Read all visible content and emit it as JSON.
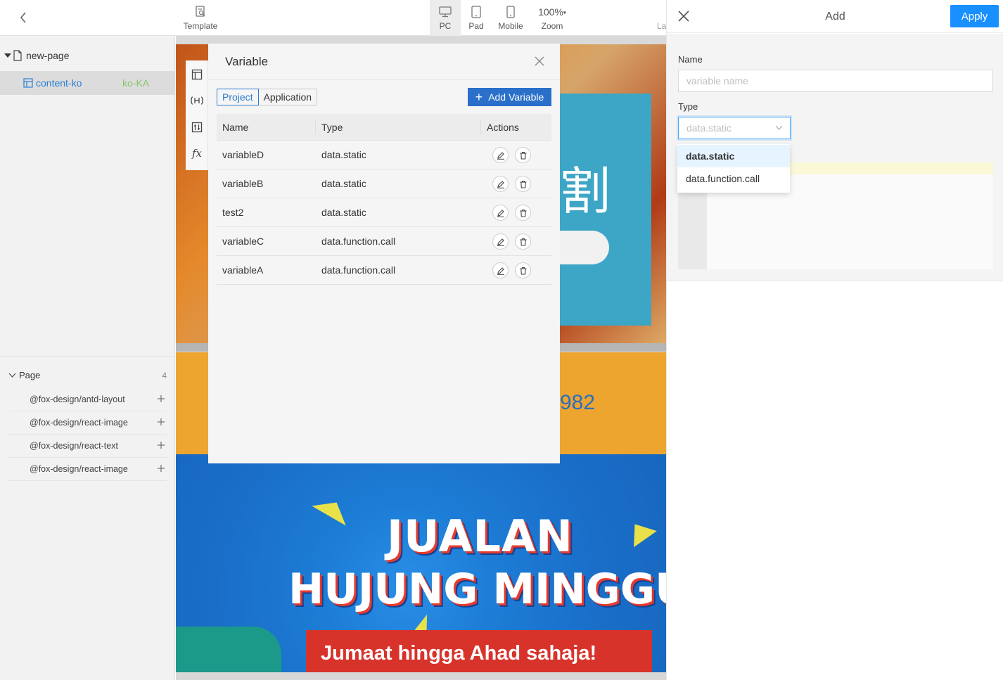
{
  "toolbar": {
    "template_label": "Template",
    "pc_label": "PC",
    "pad_label": "Pad",
    "mobile_label": "Mobile",
    "zoom_value": "100%",
    "zoom_label": "Zoom",
    "cut_label": "La"
  },
  "tree": {
    "root_label": "new-page",
    "child_label": "content-ko",
    "child_lang": "ko-KA"
  },
  "library": {
    "section_label": "Page",
    "count": "4",
    "items": [
      {
        "label": "@fox-design/antd-layout"
      },
      {
        "label": "@fox-design/react-image"
      },
      {
        "label": "@fox-design/react-text"
      },
      {
        "label": "@fox-design/react-image"
      }
    ]
  },
  "canvas": {
    "hero_char": "割",
    "orange_number": "982",
    "promo_title": "JUALAN",
    "promo_subtitle": "HUJUNG MINGGU",
    "promo_tagline": "Jumaat hingga Ahad sahaja!"
  },
  "tools": {
    "fx_label": "fx"
  },
  "variable_modal": {
    "title": "Variable",
    "tabs": [
      {
        "label": "Project",
        "active": true
      },
      {
        "label": "Application",
        "active": false
      }
    ],
    "add_button_label": "Add Variable",
    "columns": {
      "name": "Name",
      "type": "Type",
      "actions": "Actions"
    },
    "rows": [
      {
        "name": "variableD",
        "type": "data.static"
      },
      {
        "name": "variableB",
        "type": "data.static"
      },
      {
        "name": "test2",
        "type": "data.static"
      },
      {
        "name": "variableC",
        "type": "data.function.call"
      },
      {
        "name": "variableA",
        "type": "data.function.call"
      }
    ]
  },
  "drawer": {
    "title": "Add",
    "apply_label": "Apply",
    "name_label": "Name",
    "name_placeholder": "variable name",
    "type_label": "Type",
    "type_value": "data.static",
    "type_options": [
      {
        "label": "data.static",
        "selected": true
      },
      {
        "label": "data.function.call",
        "selected": false
      }
    ]
  },
  "colors": {
    "primary": "#1890ff",
    "add_variable_bg": "#2a6fc9",
    "link_blue": "#2a7fd4",
    "lang_green": "#8cc56a"
  }
}
